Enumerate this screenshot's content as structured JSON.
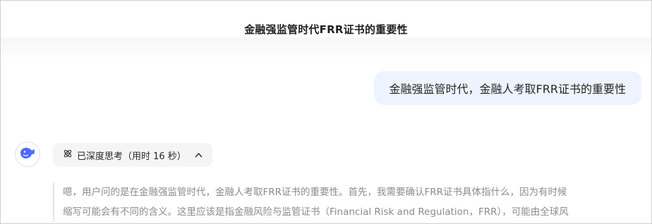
{
  "chat": {
    "title": "金融强监管时代FRR证书的重要性"
  },
  "user_message": {
    "text": "金融强监管时代，金融人考取FRR证书的重要性"
  },
  "assistant": {
    "avatar_icon": "whale-logo-icon",
    "brand_color": "#4D6BFE",
    "think_toggle": {
      "label": "已深度思考（用时 16 秒）",
      "icon": "atom-icon",
      "chevron": "chevron-up-icon"
    },
    "thinking_lines": [
      "嗯，用户问的是在金融强监管时代，金融人考取FRR证书的重要性。首先，我需要确认FRR证书具体指什么，因为有时候",
      "缩写可能会有不同的含义。这里应该是指金融风险与监管证书（Financial Risk and Regulation，FRR），可能由全球风"
    ]
  }
}
